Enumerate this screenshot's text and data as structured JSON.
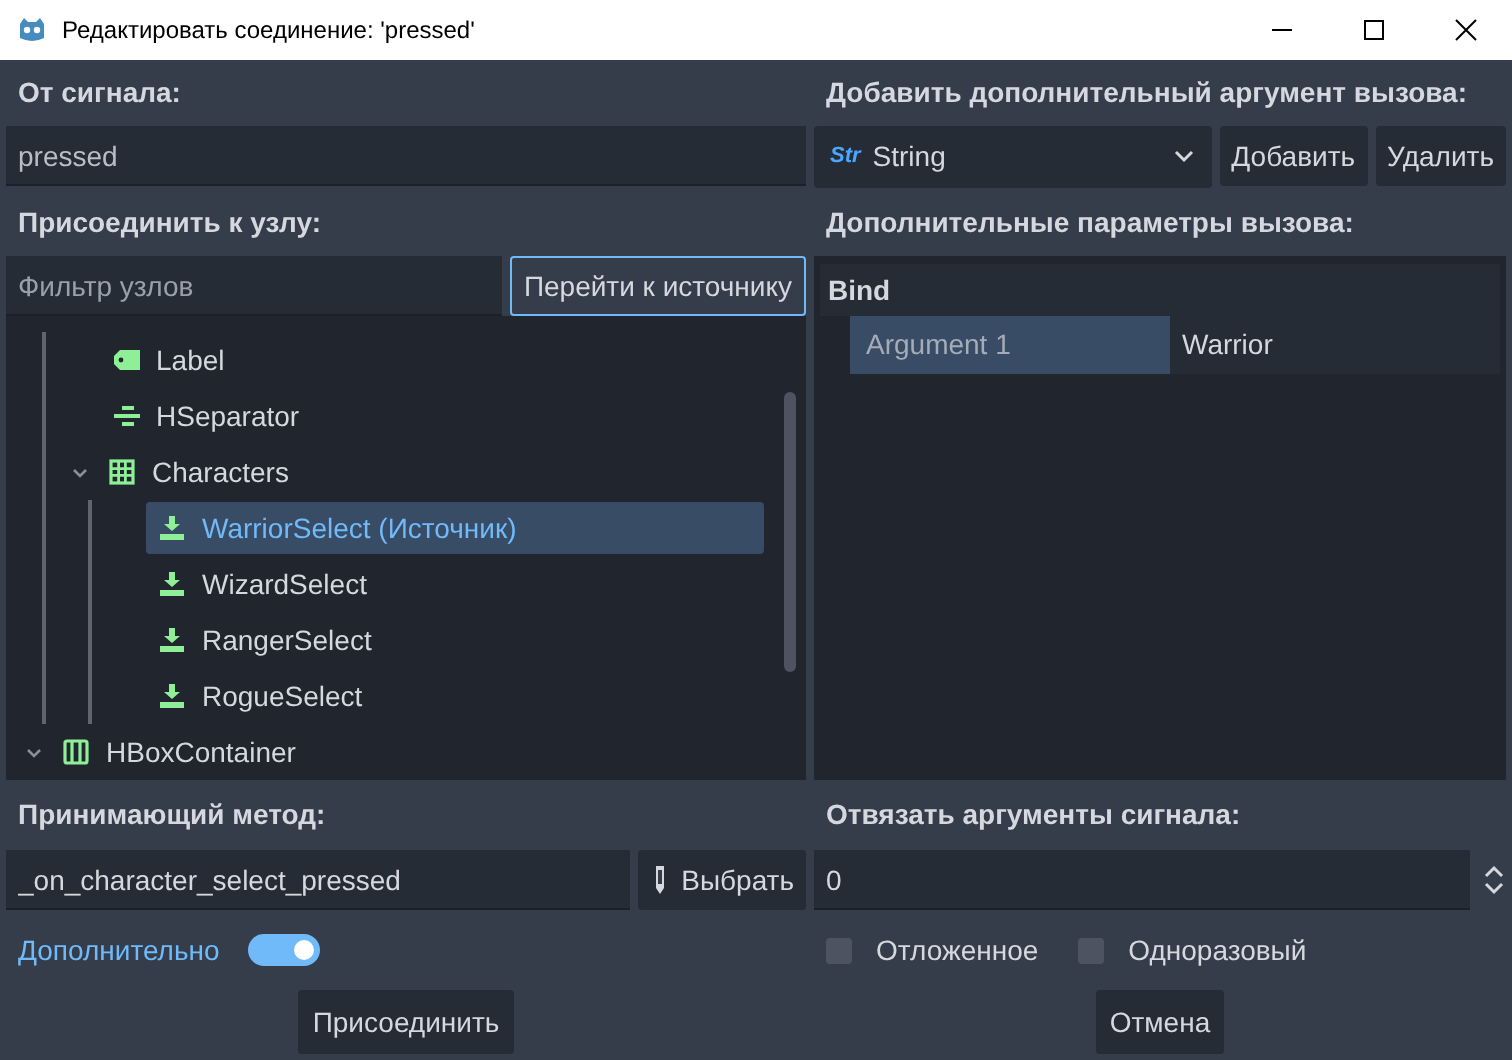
{
  "window": {
    "title": "Редактировать соединение: 'pressed'"
  },
  "signal": {
    "label": "От сигнала:",
    "value": "pressed"
  },
  "connect_to": {
    "label": "Присоединить к узлу:",
    "filter": {
      "placeholder": "Фильтр узлов"
    },
    "goto_button": "Перейти к источнику"
  },
  "tree": {
    "items": [
      {
        "children": [
          {
            "name": "Label",
            "kind": "label",
            "selected": false
          },
          {
            "name": "HSeparator",
            "kind": "separator",
            "selected": false
          },
          {
            "name": "Characters",
            "kind": "grid",
            "expanded": true,
            "selected": false,
            "children": [
              {
                "name": "WarriorSelect (Источник)",
                "kind": "button",
                "selected": true
              },
              {
                "name": "WizardSelect",
                "kind": "button",
                "selected": false
              },
              {
                "name": "RangerSelect",
                "kind": "button",
                "selected": false
              },
              {
                "name": "RogueSelect",
                "kind": "button",
                "selected": false
              }
            ]
          }
        ]
      },
      {
        "name": "HBoxContainer",
        "kind": "hbox",
        "expanded": true,
        "selected": false
      }
    ]
  },
  "method": {
    "label": "Принимающий метод:",
    "value": "_on_character_select_pressed",
    "pick_button": "Выбрать"
  },
  "advanced": {
    "label": "Дополнительно",
    "on": true
  },
  "extra_arg": {
    "label": "Добавить дополнительный аргумент вызова:",
    "type_badge": "Str",
    "type": "String",
    "add_button": "Добавить",
    "remove_button": "Удалить"
  },
  "bind": {
    "label": "Дополнительные параметры вызова:",
    "header": "Bind",
    "rows": [
      {
        "name": "Argument 1",
        "value": "Warrior"
      }
    ]
  },
  "unbind": {
    "label": "Отвязать аргументы сигнала:",
    "value": "0"
  },
  "options": [
    {
      "label": "Отложенное",
      "checked": false
    },
    {
      "label": "Одноразовый",
      "checked": false
    }
  ],
  "buttons": {
    "confirm": "Присоединить",
    "cancel": "Отмена"
  }
}
